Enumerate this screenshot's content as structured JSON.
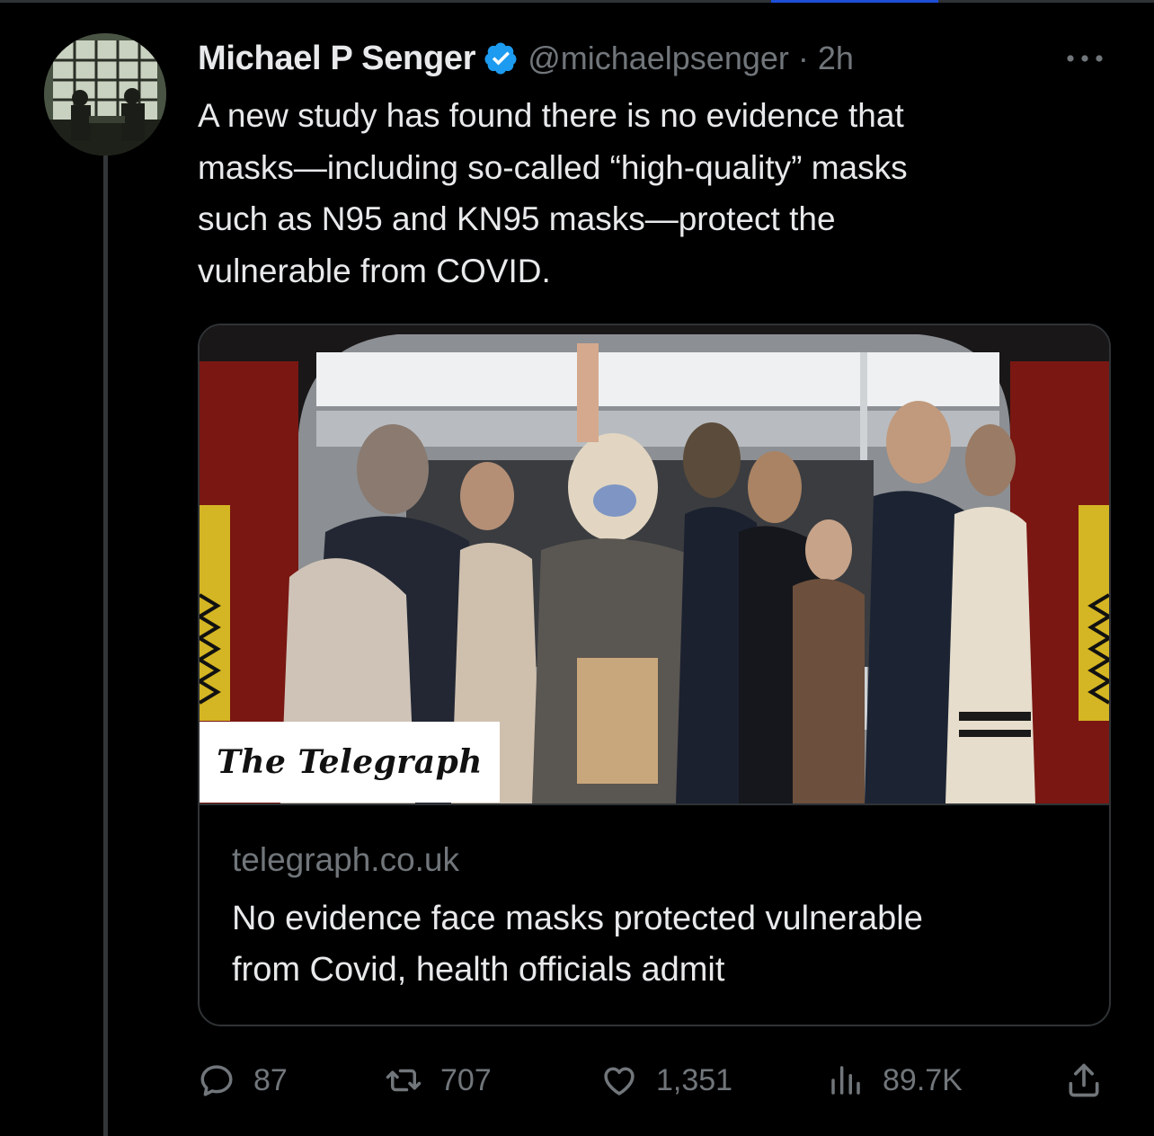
{
  "author": {
    "name": "Michael P Senger",
    "handle_time": "@michaelpsenger · 2h"
  },
  "tweet": {
    "text": "A new study has found there is no evidence that\nmasks—including so-called “high-quality” masks\nsuch as N95 and KN95 masks—protect the\nvulnerable from COVID."
  },
  "card": {
    "logo": "The Telegraph",
    "domain": "telegraph.co.uk",
    "title": "No evidence face masks protected vulnerable\nfrom Covid, health officials admit"
  },
  "actions": {
    "replies": "87",
    "reposts": "707",
    "likes": "1,351",
    "views": "89.7K"
  },
  "icons": {
    "verified": "verified-badge-icon",
    "more": "more-icon",
    "reply": "reply-icon",
    "repost": "repost-icon",
    "like": "like-icon",
    "views": "views-icon",
    "share": "share-icon"
  },
  "colors": {
    "background": "#000000",
    "text": "#e7e9ea",
    "secondary": "#71767b",
    "verified": "#1d9bf0",
    "border": "#2f3336"
  }
}
